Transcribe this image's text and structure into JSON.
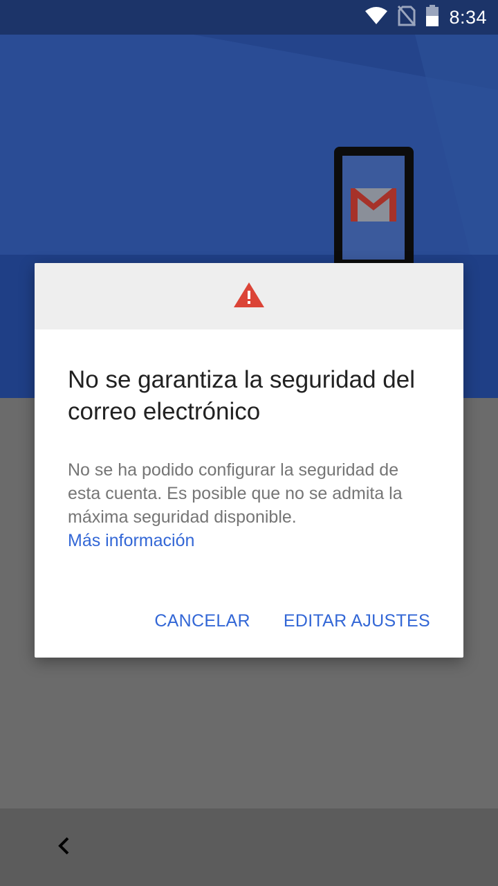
{
  "status_bar": {
    "time": "8:34",
    "icons": [
      "wifi-icon",
      "no-sim-icon",
      "battery-icon"
    ]
  },
  "illustration": {
    "icons": [
      "phone-icon",
      "gmail-envelope-icon"
    ]
  },
  "dialog": {
    "header_icon": "warning-triangle-icon",
    "title": "No se garantiza la seguridad del correo electrónico",
    "body": "No se ha podido configurar la seguridad de esta cuenta. Es posible que no se admita la máxima seguridad disponible.",
    "link": "Más información",
    "cancel_label": "CANCELAR",
    "edit_label": "EDITAR AJUSTES"
  },
  "nav_bar": {
    "back_icon": "chevron-left-icon"
  },
  "colors": {
    "status_bar": "#1c3469",
    "header_background": "#24448b",
    "scrim": "#6b6b6b",
    "accent": "#3367d6",
    "warning": "#db4437",
    "gmail_red": "#c5221f"
  }
}
